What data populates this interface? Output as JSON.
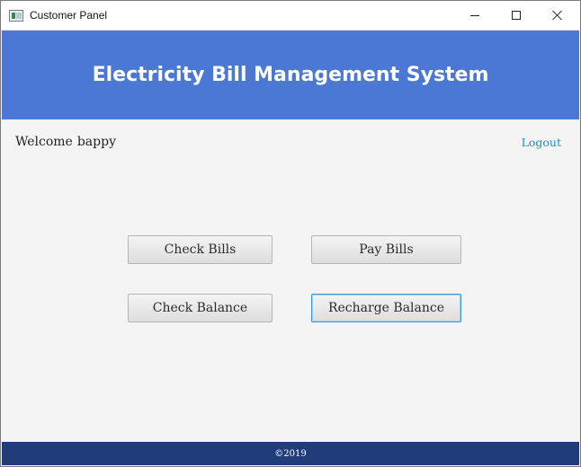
{
  "window": {
    "title": "Customer Panel",
    "controls": [
      "minimize-icon",
      "maximize-icon",
      "close-icon"
    ]
  },
  "header": {
    "title": "Electricity Bill Management System",
    "background_color": "#4a78d4"
  },
  "user_bar": {
    "welcome_label": "Welcome",
    "username": "bappy",
    "logout_label": "Logout",
    "logout_color": "#1a8fc4"
  },
  "actions": {
    "check_bills": "Check Bills",
    "pay_bills": "Pay Bills",
    "check_balance": "Check Balance",
    "recharge_balance": "Recharge Balance"
  },
  "footer": {
    "text": "©2019",
    "background_color": "#203d7a"
  }
}
